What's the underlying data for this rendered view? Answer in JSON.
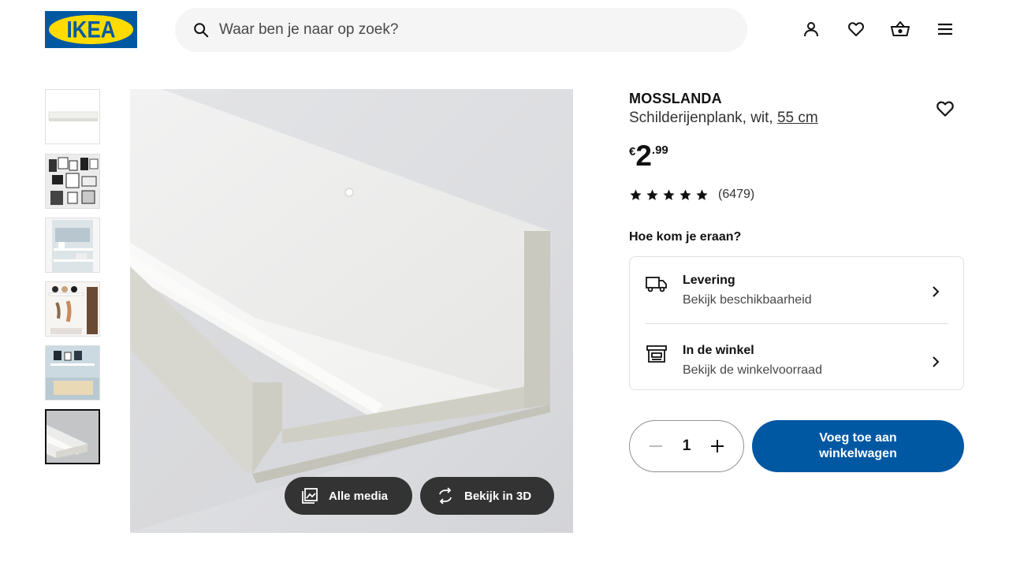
{
  "header": {
    "logo_text": "IKEA",
    "search_placeholder": "Waar ben je naar op zoek?",
    "icons": [
      "user-icon",
      "heart-icon",
      "basket-icon",
      "menu-icon"
    ]
  },
  "gallery": {
    "thumbnail_count": 6,
    "active_index": 5,
    "buttons": {
      "all_media": "Alle media",
      "view_3d": "Bekijk in 3D"
    }
  },
  "product": {
    "name": "MOSSLANDA",
    "description": "Schilderijenplank, wit,",
    "size_link": "55 cm",
    "price": {
      "currency": "€",
      "integer": "2",
      "decimal": ".99"
    },
    "rating": {
      "stars": 5,
      "count_label": "(6479)"
    }
  },
  "availability": {
    "heading": "Hoe kom je eraan?",
    "options": [
      {
        "title": "Levering",
        "subtitle": "Bekijk beschikbaarheid",
        "icon": "truck-icon"
      },
      {
        "title": "In de winkel",
        "subtitle": "Bekijk de winkelvoorraad",
        "icon": "store-icon"
      }
    ]
  },
  "purchase": {
    "quantity": "1",
    "add_to_cart_label": "Voeg toe aan winkelwagen"
  },
  "colors": {
    "brand_blue": "#0058a3",
    "brand_yellow": "#ffdb00",
    "dark_pill": "#333333"
  }
}
